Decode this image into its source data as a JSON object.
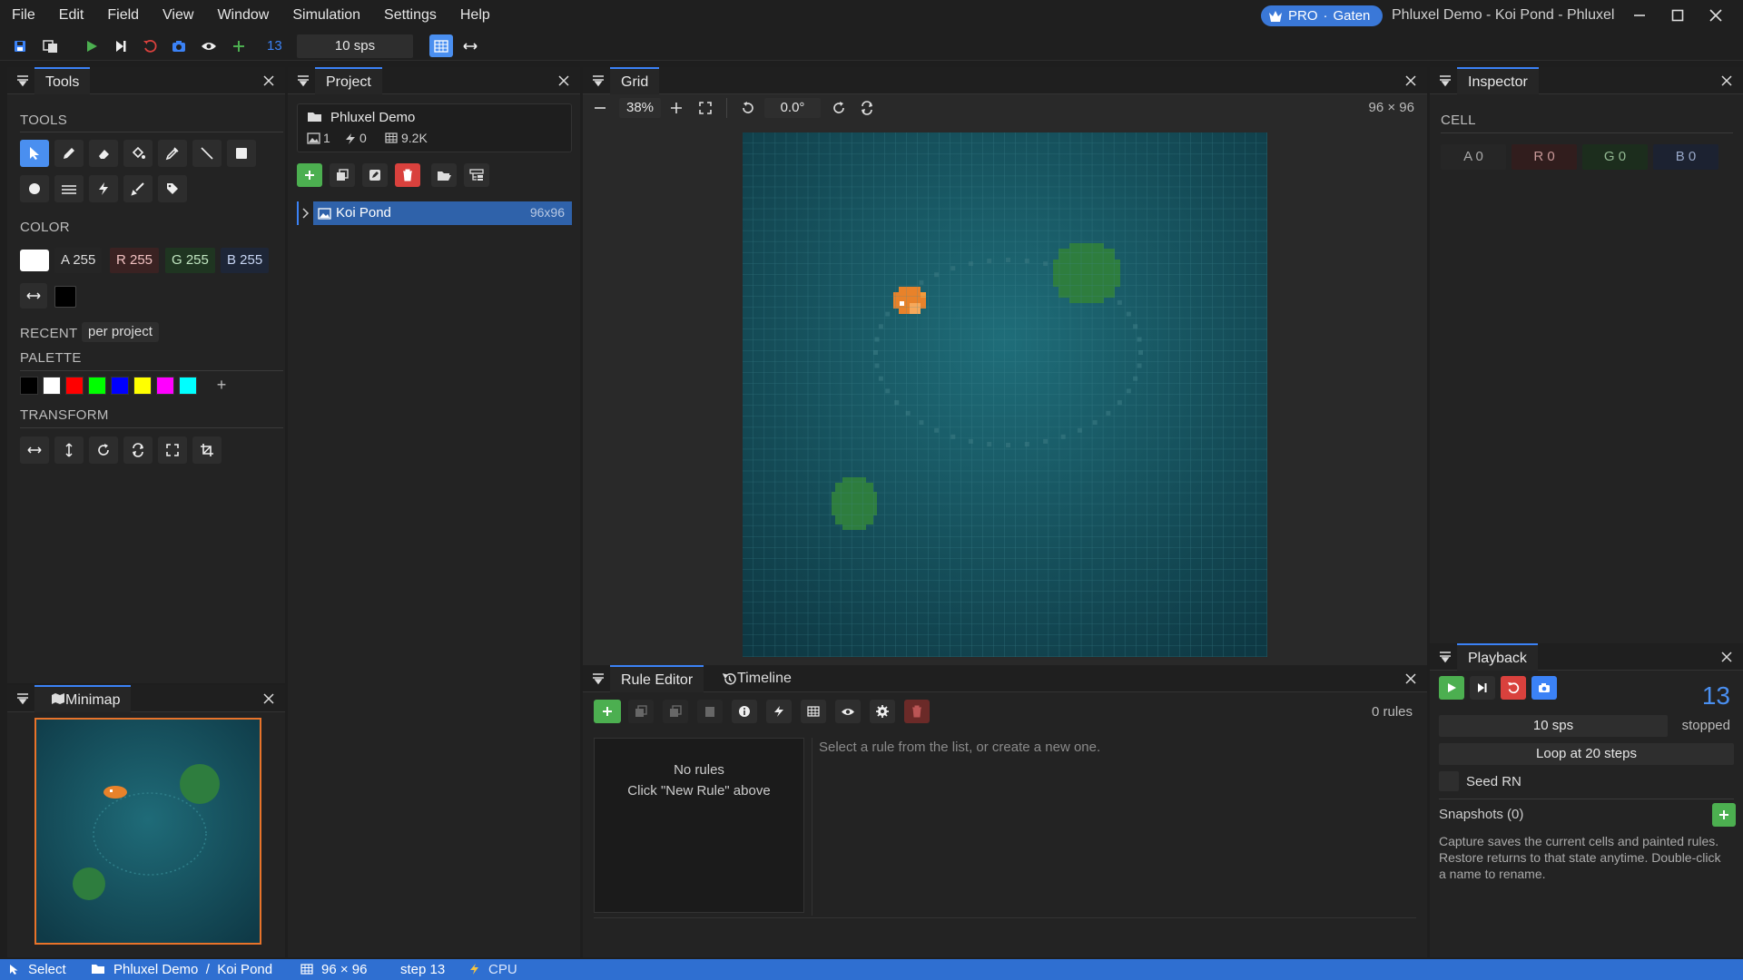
{
  "menus": [
    "File",
    "Edit",
    "Field",
    "View",
    "Window",
    "Simulation",
    "Settings",
    "Help"
  ],
  "badge": {
    "pro": "PRO",
    "separator": "·",
    "user": "Gaten"
  },
  "window_title": "Phluxel Demo - Koi Pond - Phluxel",
  "toolbar": {
    "step": "13",
    "sps": "10 sps"
  },
  "tools_panel": {
    "title": "Tools",
    "tools_label": "TOOLS",
    "color_label": "COLOR",
    "color": {
      "a": "A 255",
      "r": "R 255",
      "g": "G 255",
      "b": "B 255"
    },
    "recent_label": "RECENT",
    "recent_value": "per project",
    "palette_label": "PALETTE",
    "palette": [
      "#000000",
      "#ffffff",
      "#ff0000",
      "#00ff00",
      "#0000ff",
      "#ffff00",
      "#ff00ff",
      "#00ffff"
    ],
    "transform_label": "TRANSFORM"
  },
  "minimap": {
    "title": "Minimap"
  },
  "project": {
    "title": "Project",
    "name": "Phluxel Demo",
    "stats": {
      "images": "1",
      "rules": "0",
      "cells": "9.2K"
    },
    "items": [
      {
        "name": "Koi Pond",
        "size": "96x96"
      }
    ]
  },
  "grid": {
    "title": "Grid",
    "zoom": "38%",
    "rotation": "0.0°",
    "dims": "96 × 96",
    "cells": 48
  },
  "rule_editor": {
    "tab1": "Rule Editor",
    "tab2": "Timeline",
    "count": "0 rules",
    "empty1": "No rules",
    "empty2": "Click \"New Rule\" above",
    "hint": "Select a rule from the list, or create a new one."
  },
  "inspector": {
    "title": "Inspector",
    "cell_label": "CELL",
    "a": "A 0",
    "r": "R 0",
    "g": "G 0",
    "b": "B 0"
  },
  "playback": {
    "title": "Playback",
    "step": "13",
    "sps": "10 sps",
    "state": "stopped",
    "loop": "Loop at 20 steps",
    "seed": "Seed RN",
    "snapshots": "Snapshots (0)",
    "help": "Capture saves the current cells and painted rules. Restore returns to that state anytime. Double-click a name to rename."
  },
  "statusbar": {
    "tool": "Select",
    "path": "Phluxel Demo  /  Koi Pond",
    "dims": "96 × 96",
    "step": "step 13",
    "device": "CPU"
  },
  "colors": {
    "accent": "#3b82f6",
    "green": "#4caf50",
    "red": "#d9413d",
    "pond": "#1d5a66",
    "fish": "#e8822a",
    "pad": "#2e7d3e"
  }
}
